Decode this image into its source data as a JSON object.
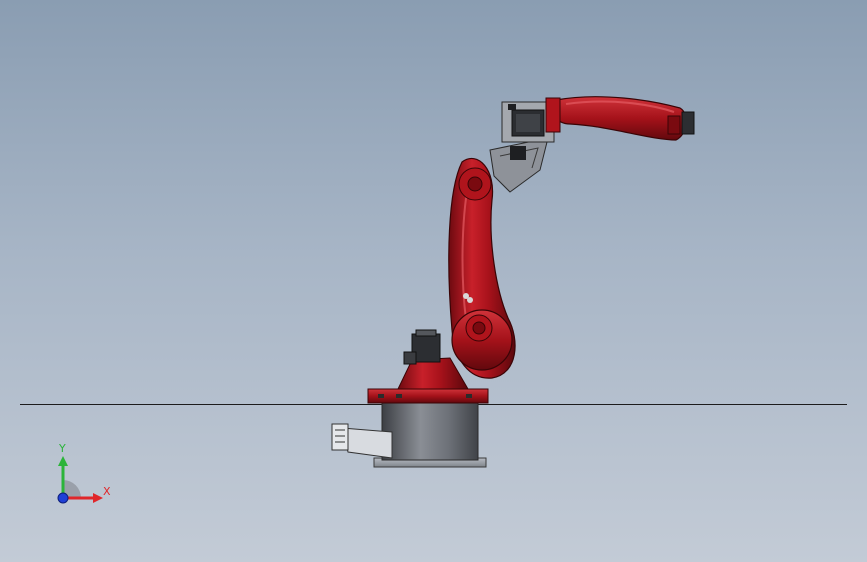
{
  "viewport": {
    "background_top": "#8a9db2",
    "background_bottom": "#c3cbd6",
    "model_color": "#b0141c",
    "base_color": "#6f737a"
  },
  "triad": {
    "y_label": "Y",
    "x_label": "X",
    "y_color": "#2bb43a",
    "x_color": "#e0262a",
    "z_color": "#1f3fd6"
  }
}
